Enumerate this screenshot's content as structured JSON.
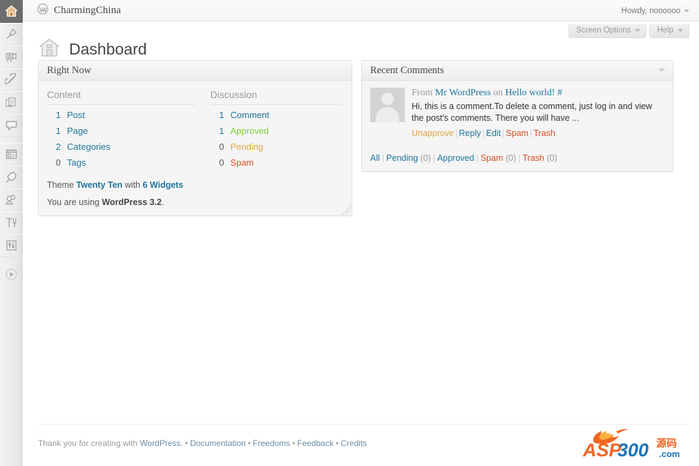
{
  "adminbar": {
    "site_name": "CharmingChina",
    "wp_logo_icon": "wordpress-logo-icon",
    "howdy": "Howdy, noooooo",
    "howdy_caret_icon": "chevron-down-icon"
  },
  "screen_meta": {
    "screen_options_label": "Screen Options",
    "help_label": "Help",
    "caret_icon": "chevron-down-icon"
  },
  "page": {
    "title": "Dashboard",
    "title_icon": "dashboard-home-icon"
  },
  "sidebar": {
    "items": [
      {
        "name": "dashboard",
        "icon": "home-icon",
        "active": true
      },
      {
        "name": "posts",
        "icon": "pin-icon",
        "active": false
      },
      {
        "name": "media",
        "icon": "media-camera-icon",
        "active": false
      },
      {
        "name": "links",
        "icon": "link-chain-icon",
        "active": false
      },
      {
        "name": "pages",
        "icon": "pages-document-icon",
        "active": false
      },
      {
        "name": "comments",
        "icon": "comment-bubble-icon",
        "active": false
      },
      {
        "name": "appearance",
        "icon": "appearance-layout-icon",
        "active": false
      },
      {
        "name": "plugins",
        "icon": "plugin-plug-icon",
        "active": false
      },
      {
        "name": "users",
        "icon": "users-icon",
        "active": false
      },
      {
        "name": "tools",
        "icon": "tools-hammer-icon",
        "active": false
      },
      {
        "name": "settings",
        "icon": "settings-sliders-icon",
        "active": false
      },
      {
        "name": "collapse-menu",
        "icon": "collapse-play-icon",
        "active": false
      }
    ]
  },
  "right_now": {
    "title": "Right Now",
    "content_header": "Content",
    "discussion_header": "Discussion",
    "content_rows": [
      {
        "count": "1",
        "label": "Post",
        "color": "c-blue"
      },
      {
        "count": "1",
        "label": "Page",
        "color": "c-blue"
      },
      {
        "count": "2",
        "label": "Categories",
        "color": "c-blue"
      },
      {
        "count": "0",
        "label": "Tags",
        "color": "c-blue"
      }
    ],
    "discussion_rows": [
      {
        "count": "1",
        "label": "Comment",
        "color": "c-blue"
      },
      {
        "count": "1",
        "label": "Approved",
        "color": "c-green"
      },
      {
        "count": "0",
        "label": "Pending",
        "color": "c-orange"
      },
      {
        "count": "0",
        "label": "Spam",
        "color": "c-red"
      }
    ],
    "theme_prefix": "Theme ",
    "theme_name": "Twenty Ten",
    "theme_mid": " with ",
    "widgets": "6 Widgets",
    "version_prefix": "You are using ",
    "version": "WordPress 3.2",
    "version_suffix": "."
  },
  "recent_comments": {
    "title": "Recent Comments",
    "toggle_icon": "chevron-down-icon",
    "comment": {
      "from_prefix": "From ",
      "author": "Mr WordPress",
      "on": " on ",
      "post": "Hello world!",
      "hash": "#",
      "text": "Hi, this is a comment.To delete a comment, just log in and view the post's comments. There you will have ...",
      "actions": [
        {
          "label": "Unapprove",
          "color": "c-orange"
        },
        {
          "label": "Reply",
          "color": "c-blue"
        },
        {
          "label": "Edit",
          "color": "c-blue"
        },
        {
          "label": "Spam",
          "color": "c-red"
        },
        {
          "label": "Trash",
          "color": "c-red"
        }
      ]
    },
    "filters": [
      {
        "label": "All",
        "count": "",
        "color": "c-blue"
      },
      {
        "label": "Pending",
        "count": "(0)",
        "color": "c-blue"
      },
      {
        "label": "Approved",
        "count": "",
        "color": "c-blue"
      },
      {
        "label": "Spam",
        "count": "(0)",
        "color": "c-red"
      },
      {
        "label": "Trash",
        "count": "(0)",
        "color": "c-red"
      }
    ]
  },
  "footer": {
    "thanks_prefix": "Thank you for creating with ",
    "wordpress": "WordPress",
    "thanks_suffix": ".",
    "links": [
      "Documentation",
      "Freedoms",
      "Feedback",
      "Credits"
    ]
  },
  "watermark": {
    "text_asp": "ASP",
    "text_300": "300",
    "text_cn": "源码",
    "text_com": ".com",
    "icon": "flame-logo-icon",
    "color_orange": "#f26522",
    "color_blue": "#1b75bb"
  }
}
